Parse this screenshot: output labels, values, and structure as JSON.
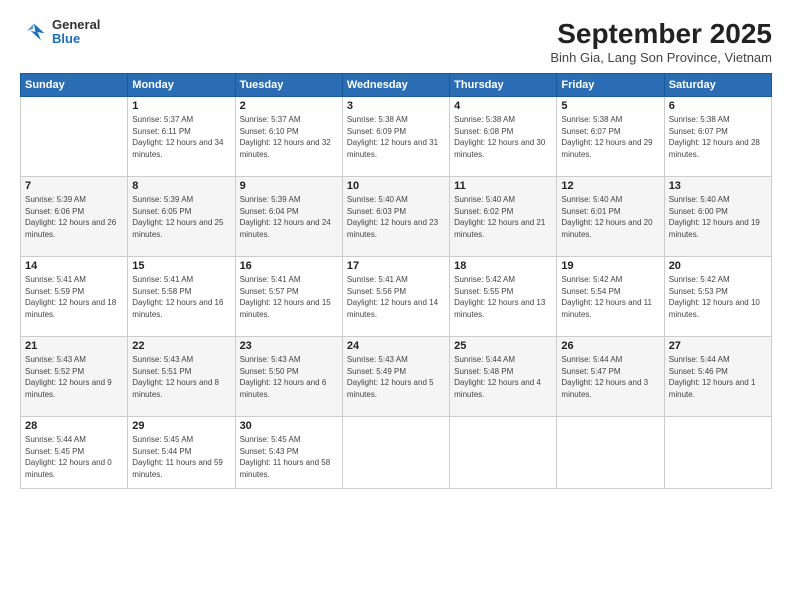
{
  "logo": {
    "general": "General",
    "blue": "Blue"
  },
  "title": "September 2025",
  "location": "Binh Gia, Lang Son Province, Vietnam",
  "days_of_week": [
    "Sunday",
    "Monday",
    "Tuesday",
    "Wednesday",
    "Thursday",
    "Friday",
    "Saturday"
  ],
  "weeks": [
    [
      {
        "day": "",
        "sunrise": "",
        "sunset": "",
        "daylight": ""
      },
      {
        "day": "1",
        "sunrise": "Sunrise: 5:37 AM",
        "sunset": "Sunset: 6:11 PM",
        "daylight": "Daylight: 12 hours and 34 minutes."
      },
      {
        "day": "2",
        "sunrise": "Sunrise: 5:37 AM",
        "sunset": "Sunset: 6:10 PM",
        "daylight": "Daylight: 12 hours and 32 minutes."
      },
      {
        "day": "3",
        "sunrise": "Sunrise: 5:38 AM",
        "sunset": "Sunset: 6:09 PM",
        "daylight": "Daylight: 12 hours and 31 minutes."
      },
      {
        "day": "4",
        "sunrise": "Sunrise: 5:38 AM",
        "sunset": "Sunset: 6:08 PM",
        "daylight": "Daylight: 12 hours and 30 minutes."
      },
      {
        "day": "5",
        "sunrise": "Sunrise: 5:38 AM",
        "sunset": "Sunset: 6:07 PM",
        "daylight": "Daylight: 12 hours and 29 minutes."
      },
      {
        "day": "6",
        "sunrise": "Sunrise: 5:38 AM",
        "sunset": "Sunset: 6:07 PM",
        "daylight": "Daylight: 12 hours and 28 minutes."
      }
    ],
    [
      {
        "day": "7",
        "sunrise": "Sunrise: 5:39 AM",
        "sunset": "Sunset: 6:06 PM",
        "daylight": "Daylight: 12 hours and 26 minutes."
      },
      {
        "day": "8",
        "sunrise": "Sunrise: 5:39 AM",
        "sunset": "Sunset: 6:05 PM",
        "daylight": "Daylight: 12 hours and 25 minutes."
      },
      {
        "day": "9",
        "sunrise": "Sunrise: 5:39 AM",
        "sunset": "Sunset: 6:04 PM",
        "daylight": "Daylight: 12 hours and 24 minutes."
      },
      {
        "day": "10",
        "sunrise": "Sunrise: 5:40 AM",
        "sunset": "Sunset: 6:03 PM",
        "daylight": "Daylight: 12 hours and 23 minutes."
      },
      {
        "day": "11",
        "sunrise": "Sunrise: 5:40 AM",
        "sunset": "Sunset: 6:02 PM",
        "daylight": "Daylight: 12 hours and 21 minutes."
      },
      {
        "day": "12",
        "sunrise": "Sunrise: 5:40 AM",
        "sunset": "Sunset: 6:01 PM",
        "daylight": "Daylight: 12 hours and 20 minutes."
      },
      {
        "day": "13",
        "sunrise": "Sunrise: 5:40 AM",
        "sunset": "Sunset: 6:00 PM",
        "daylight": "Daylight: 12 hours and 19 minutes."
      }
    ],
    [
      {
        "day": "14",
        "sunrise": "Sunrise: 5:41 AM",
        "sunset": "Sunset: 5:59 PM",
        "daylight": "Daylight: 12 hours and 18 minutes."
      },
      {
        "day": "15",
        "sunrise": "Sunrise: 5:41 AM",
        "sunset": "Sunset: 5:58 PM",
        "daylight": "Daylight: 12 hours and 16 minutes."
      },
      {
        "day": "16",
        "sunrise": "Sunrise: 5:41 AM",
        "sunset": "Sunset: 5:57 PM",
        "daylight": "Daylight: 12 hours and 15 minutes."
      },
      {
        "day": "17",
        "sunrise": "Sunrise: 5:41 AM",
        "sunset": "Sunset: 5:56 PM",
        "daylight": "Daylight: 12 hours and 14 minutes."
      },
      {
        "day": "18",
        "sunrise": "Sunrise: 5:42 AM",
        "sunset": "Sunset: 5:55 PM",
        "daylight": "Daylight: 12 hours and 13 minutes."
      },
      {
        "day": "19",
        "sunrise": "Sunrise: 5:42 AM",
        "sunset": "Sunset: 5:54 PM",
        "daylight": "Daylight: 12 hours and 11 minutes."
      },
      {
        "day": "20",
        "sunrise": "Sunrise: 5:42 AM",
        "sunset": "Sunset: 5:53 PM",
        "daylight": "Daylight: 12 hours and 10 minutes."
      }
    ],
    [
      {
        "day": "21",
        "sunrise": "Sunrise: 5:43 AM",
        "sunset": "Sunset: 5:52 PM",
        "daylight": "Daylight: 12 hours and 9 minutes."
      },
      {
        "day": "22",
        "sunrise": "Sunrise: 5:43 AM",
        "sunset": "Sunset: 5:51 PM",
        "daylight": "Daylight: 12 hours and 8 minutes."
      },
      {
        "day": "23",
        "sunrise": "Sunrise: 5:43 AM",
        "sunset": "Sunset: 5:50 PM",
        "daylight": "Daylight: 12 hours and 6 minutes."
      },
      {
        "day": "24",
        "sunrise": "Sunrise: 5:43 AM",
        "sunset": "Sunset: 5:49 PM",
        "daylight": "Daylight: 12 hours and 5 minutes."
      },
      {
        "day": "25",
        "sunrise": "Sunrise: 5:44 AM",
        "sunset": "Sunset: 5:48 PM",
        "daylight": "Daylight: 12 hours and 4 minutes."
      },
      {
        "day": "26",
        "sunrise": "Sunrise: 5:44 AM",
        "sunset": "Sunset: 5:47 PM",
        "daylight": "Daylight: 12 hours and 3 minutes."
      },
      {
        "day": "27",
        "sunrise": "Sunrise: 5:44 AM",
        "sunset": "Sunset: 5:46 PM",
        "daylight": "Daylight: 12 hours and 1 minute."
      }
    ],
    [
      {
        "day": "28",
        "sunrise": "Sunrise: 5:44 AM",
        "sunset": "Sunset: 5:45 PM",
        "daylight": "Daylight: 12 hours and 0 minutes."
      },
      {
        "day": "29",
        "sunrise": "Sunrise: 5:45 AM",
        "sunset": "Sunset: 5:44 PM",
        "daylight": "Daylight: 11 hours and 59 minutes."
      },
      {
        "day": "30",
        "sunrise": "Sunrise: 5:45 AM",
        "sunset": "Sunset: 5:43 PM",
        "daylight": "Daylight: 11 hours and 58 minutes."
      },
      {
        "day": "",
        "sunrise": "",
        "sunset": "",
        "daylight": ""
      },
      {
        "day": "",
        "sunrise": "",
        "sunset": "",
        "daylight": ""
      },
      {
        "day": "",
        "sunrise": "",
        "sunset": "",
        "daylight": ""
      },
      {
        "day": "",
        "sunrise": "",
        "sunset": "",
        "daylight": ""
      }
    ]
  ]
}
